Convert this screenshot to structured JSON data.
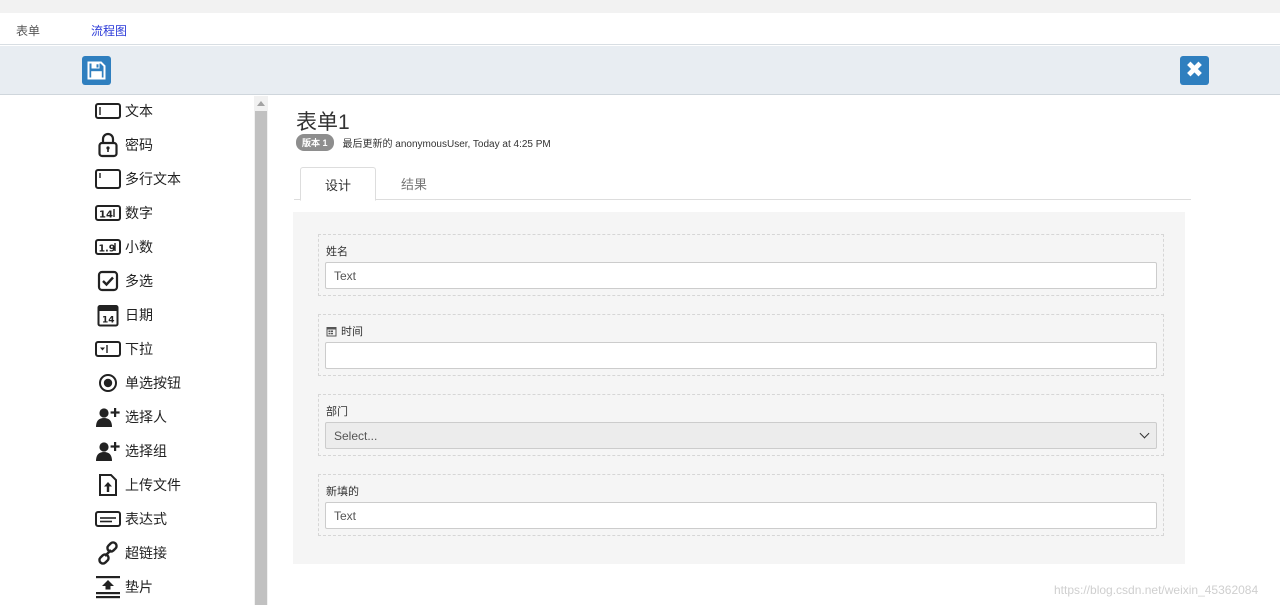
{
  "nav": {
    "form_tab": "表单",
    "flow_tab": "流程图"
  },
  "toolbar": {
    "save_icon": "floppy-disk-icon",
    "close_icon": "close-x-icon",
    "close_glyph": "✖",
    "accent": "#2f7fbf"
  },
  "palette": {
    "items": [
      {
        "label": "文本",
        "icon": "text-field-icon"
      },
      {
        "label": "密码",
        "icon": "lock-icon"
      },
      {
        "label": "多行文本",
        "icon": "multiline-text-icon"
      },
      {
        "label": "数字",
        "icon": "number-icon"
      },
      {
        "label": "小数",
        "icon": "decimal-icon"
      },
      {
        "label": "多选",
        "icon": "checkbox-icon"
      },
      {
        "label": "日期",
        "icon": "calendar-icon"
      },
      {
        "label": "下拉",
        "icon": "dropdown-icon"
      },
      {
        "label": "单选按钮",
        "icon": "radio-icon"
      },
      {
        "label": "选择人",
        "icon": "add-user-icon"
      },
      {
        "label": "选择组",
        "icon": "add-group-icon"
      },
      {
        "label": "上传文件",
        "icon": "upload-file-icon"
      },
      {
        "label": "表达式",
        "icon": "expression-icon"
      },
      {
        "label": "超链接",
        "icon": "link-icon"
      },
      {
        "label": "垫片",
        "icon": "spacer-icon"
      }
    ]
  },
  "form": {
    "title": "表单1",
    "version_badge": "版本 1",
    "last_updated": "最后更新的 anonymousUser, Today at 4:25 PM",
    "tabs": {
      "design": "设计",
      "result": "结果"
    },
    "fields": [
      {
        "label": "姓名",
        "value": "Text",
        "type": "text"
      },
      {
        "label": "时间",
        "value": "",
        "type": "date",
        "icon": "calendar-icon"
      },
      {
        "label": "部门",
        "value": "Select...",
        "type": "select"
      },
      {
        "label": "新填的",
        "value": "Text",
        "type": "text"
      }
    ]
  },
  "watermark": "https://blog.csdn.net/weixin_45362084"
}
